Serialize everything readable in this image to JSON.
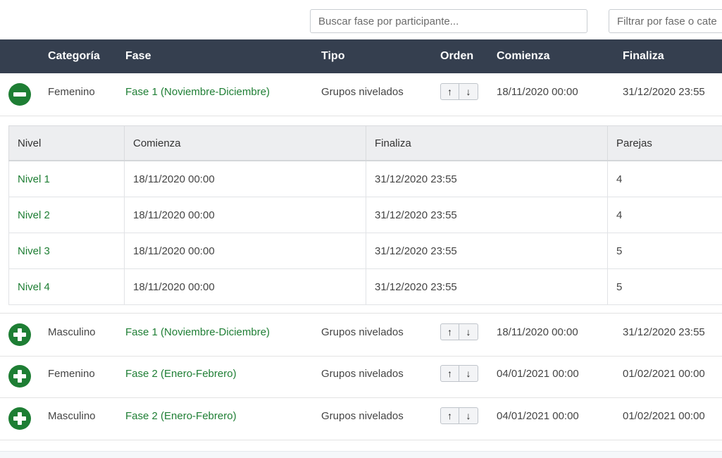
{
  "search": {
    "participant_placeholder": "Buscar fase por participante...",
    "filter_placeholder": "Filtrar por fase o cate"
  },
  "table": {
    "headers": {
      "category": "Categoría",
      "phase": "Fase",
      "type": "Tipo",
      "order": "Orden",
      "start": "Comienza",
      "end": "Finaliza"
    },
    "rows": [
      {
        "category": "Femenino",
        "phase": "Fase 1 (Noviembre-Diciembre)",
        "type": "Grupos nivelados",
        "start": "18/11/2020 00:00",
        "end": "31/12/2020 23:55",
        "expanded": true
      },
      {
        "category": "Masculino",
        "phase": "Fase 1 (Noviembre-Diciembre)",
        "type": "Grupos nivelados",
        "start": "18/11/2020 00:00",
        "end": "31/12/2020 23:55",
        "expanded": false
      },
      {
        "category": "Femenino",
        "phase": "Fase 2 (Enero-Febrero)",
        "type": "Grupos nivelados",
        "start": "04/01/2021 00:00",
        "end": "01/02/2021 00:00",
        "expanded": false
      },
      {
        "category": "Masculino",
        "phase": "Fase 2 (Enero-Febrero)",
        "type": "Grupos nivelados",
        "start": "04/01/2021 00:00",
        "end": "01/02/2021 00:00",
        "expanded": false
      }
    ]
  },
  "order_buttons": {
    "up": "↑",
    "down": "↓"
  },
  "subtable": {
    "headers": {
      "level": "Nivel",
      "start": "Comienza",
      "end": "Finaliza",
      "pairs": "Parejas"
    },
    "rows": [
      {
        "level": "Nivel 1",
        "start": "18/11/2020 00:00",
        "end": "31/12/2020 23:55",
        "pairs": "4"
      },
      {
        "level": "Nivel 2",
        "start": "18/11/2020 00:00",
        "end": "31/12/2020 23:55",
        "pairs": "4"
      },
      {
        "level": "Nivel 3",
        "start": "18/11/2020 00:00",
        "end": "31/12/2020 23:55",
        "pairs": "5"
      },
      {
        "level": "Nivel 4",
        "start": "18/11/2020 00:00",
        "end": "31/12/2020 23:55",
        "pairs": "5"
      }
    ]
  },
  "colors": {
    "header_bg": "#353f4f",
    "accent_green": "#1e7e34"
  }
}
